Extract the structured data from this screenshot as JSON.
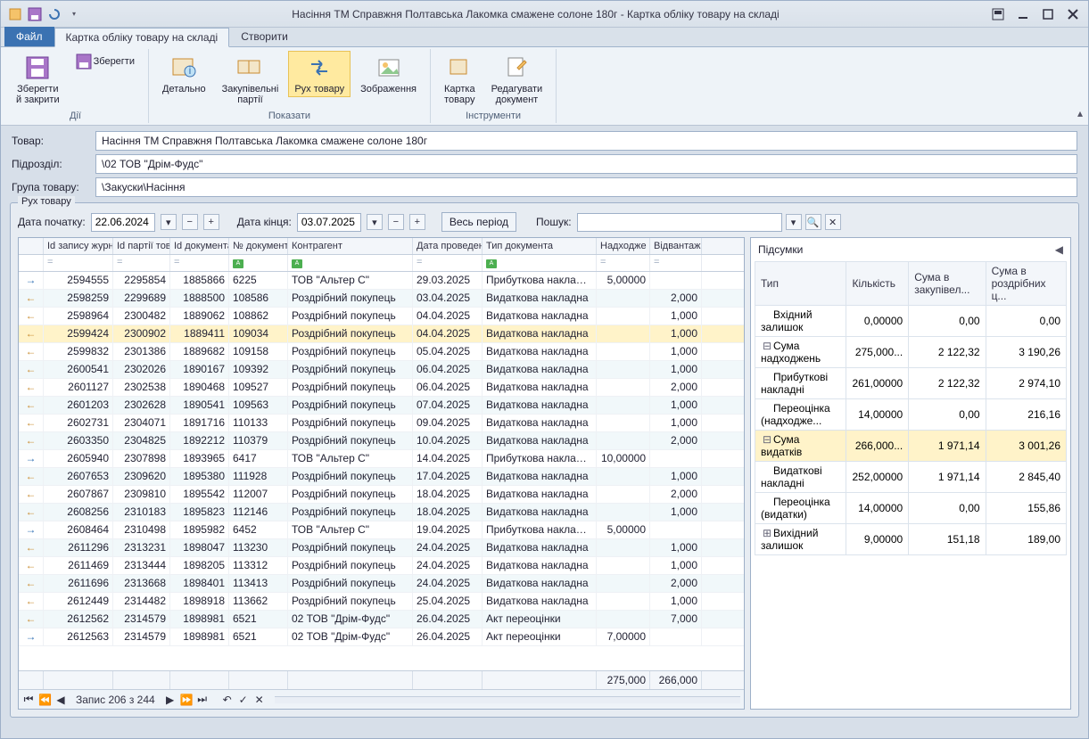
{
  "window": {
    "title": "Насіння ТМ Справжня Полтавська Лакомка смажене солоне 180г - Картка обліку товару на складі"
  },
  "tabs": {
    "file": "Файл",
    "card": "Картка обліку товару на складі",
    "create": "Створити"
  },
  "ribbon": {
    "actions_label": "Дії",
    "show_label": "Показати",
    "tools_label": "Інструменти",
    "save_close": "Зберегти\nй закрити",
    "save": "Зберегти",
    "detailed": "Детально",
    "purchase_batches": "Закупівельні\nпартії",
    "movement": "Рух товару",
    "image": "Зображення",
    "card": "Картка\nтовару",
    "edit_doc": "Редагувати\nдокумент"
  },
  "form": {
    "product_label": "Товар:",
    "product_value": "Насіння ТМ Справжня Полтавська Лакомка смажене солоне 180г",
    "division_label": "Підрозділ:",
    "division_value": "\\02 ТОВ \"Дрім-Фудс\"",
    "group_label": "Група товару:",
    "group_value": "\\Закуски\\Насіння"
  },
  "fieldset_legend": "Рух товару",
  "filter": {
    "dstart_label": "Дата початку:",
    "dstart": "22.06.2024",
    "dend_label": "Дата кінця:",
    "dend": "03.07.2025",
    "whole": "Весь період",
    "search_label": "Пошук:"
  },
  "cols": {
    "c0": "",
    "c1": "Id запису журналу о...",
    "c2": "Id партії товару",
    "c3": "Id документа",
    "c4": "№ документа",
    "c5": "Контрагент",
    "c6": "Дата проведення",
    "c7": "Тип документа",
    "c8": "Надходже ння",
    "c9": "Відвантаж ення"
  },
  "rows": [
    {
      "d": "in",
      "c1": "2594555",
      "c2": "2295854",
      "c3": "1885866",
      "c4": "6225",
      "c5": "ТОВ \"Альтер С\"",
      "c6": "29.03.2025",
      "c7": "Прибуткова накладна",
      "c8": "5,00000",
      "c9": ""
    },
    {
      "d": "out",
      "c1": "2598259",
      "c2": "2299689",
      "c3": "1888500",
      "c4": "108586",
      "c5": "Роздрібний покупець",
      "c6": "03.04.2025",
      "c7": "Видаткова накладна",
      "c8": "",
      "c9": "2,000"
    },
    {
      "d": "out",
      "c1": "2598964",
      "c2": "2300482",
      "c3": "1889062",
      "c4": "108862",
      "c5": "Роздрібний покупець",
      "c6": "04.04.2025",
      "c7": "Видаткова накладна",
      "c8": "",
      "c9": "1,000"
    },
    {
      "d": "out",
      "sel": true,
      "c1": "2599424",
      "c2": "2300902",
      "c3": "1889411",
      "c4": "109034",
      "c5": "Роздрібний покупець",
      "c6": "04.04.2025",
      "c7": "Видаткова накладна",
      "c8": "",
      "c9": "1,000"
    },
    {
      "d": "out",
      "c1": "2599832",
      "c2": "2301386",
      "c3": "1889682",
      "c4": "109158",
      "c5": "Роздрібний покупець",
      "c6": "05.04.2025",
      "c7": "Видаткова накладна",
      "c8": "",
      "c9": "1,000"
    },
    {
      "d": "out",
      "c1": "2600541",
      "c2": "2302026",
      "c3": "1890167",
      "c4": "109392",
      "c5": "Роздрібний покупець",
      "c6": "06.04.2025",
      "c7": "Видаткова накладна",
      "c8": "",
      "c9": "1,000"
    },
    {
      "d": "out",
      "c1": "2601127",
      "c2": "2302538",
      "c3": "1890468",
      "c4": "109527",
      "c5": "Роздрібний покупець",
      "c6": "06.04.2025",
      "c7": "Видаткова накладна",
      "c8": "",
      "c9": "2,000"
    },
    {
      "d": "out",
      "c1": "2601203",
      "c2": "2302628",
      "c3": "1890541",
      "c4": "109563",
      "c5": "Роздрібний покупець",
      "c6": "07.04.2025",
      "c7": "Видаткова накладна",
      "c8": "",
      "c9": "1,000"
    },
    {
      "d": "out",
      "c1": "2602731",
      "c2": "2304071",
      "c3": "1891716",
      "c4": "110133",
      "c5": "Роздрібний покупець",
      "c6": "09.04.2025",
      "c7": "Видаткова накладна",
      "c8": "",
      "c9": "1,000"
    },
    {
      "d": "out",
      "c1": "2603350",
      "c2": "2304825",
      "c3": "1892212",
      "c4": "110379",
      "c5": "Роздрібний покупець",
      "c6": "10.04.2025",
      "c7": "Видаткова накладна",
      "c8": "",
      "c9": "2,000"
    },
    {
      "d": "in",
      "c1": "2605940",
      "c2": "2307898",
      "c3": "1893965",
      "c4": "6417",
      "c5": "ТОВ \"Альтер С\"",
      "c6": "14.04.2025",
      "c7": "Прибуткова накладна",
      "c8": "10,00000",
      "c9": ""
    },
    {
      "d": "out",
      "c1": "2607653",
      "c2": "2309620",
      "c3": "1895380",
      "c4": "111928",
      "c5": "Роздрібний покупець",
      "c6": "17.04.2025",
      "c7": "Видаткова накладна",
      "c8": "",
      "c9": "1,000"
    },
    {
      "d": "out",
      "c1": "2607867",
      "c2": "2309810",
      "c3": "1895542",
      "c4": "112007",
      "c5": "Роздрібний покупець",
      "c6": "18.04.2025",
      "c7": "Видаткова накладна",
      "c8": "",
      "c9": "2,000"
    },
    {
      "d": "out",
      "c1": "2608256",
      "c2": "2310183",
      "c3": "1895823",
      "c4": "112146",
      "c5": "Роздрібний покупець",
      "c6": "18.04.2025",
      "c7": "Видаткова накладна",
      "c8": "",
      "c9": "1,000"
    },
    {
      "d": "in",
      "c1": "2608464",
      "c2": "2310498",
      "c3": "1895982",
      "c4": "6452",
      "c5": "ТОВ \"Альтер С\"",
      "c6": "19.04.2025",
      "c7": "Прибуткова накладна",
      "c8": "5,00000",
      "c9": ""
    },
    {
      "d": "out",
      "c1": "2611296",
      "c2": "2313231",
      "c3": "1898047",
      "c4": "113230",
      "c5": "Роздрібний покупець",
      "c6": "24.04.2025",
      "c7": "Видаткова накладна",
      "c8": "",
      "c9": "1,000"
    },
    {
      "d": "out",
      "c1": "2611469",
      "c2": "2313444",
      "c3": "1898205",
      "c4": "113312",
      "c5": "Роздрібний покупець",
      "c6": "24.04.2025",
      "c7": "Видаткова накладна",
      "c8": "",
      "c9": "1,000"
    },
    {
      "d": "out",
      "c1": "2611696",
      "c2": "2313668",
      "c3": "1898401",
      "c4": "113413",
      "c5": "Роздрібний покупець",
      "c6": "24.04.2025",
      "c7": "Видаткова накладна",
      "c8": "",
      "c9": "2,000"
    },
    {
      "d": "out",
      "c1": "2612449",
      "c2": "2314482",
      "c3": "1898918",
      "c4": "113662",
      "c5": "Роздрібний покупець",
      "c6": "25.04.2025",
      "c7": "Видаткова накладна",
      "c8": "",
      "c9": "1,000"
    },
    {
      "d": "out",
      "c1": "2612562",
      "c2": "2314579",
      "c3": "1898981",
      "c4": "6521",
      "c5": "02 ТОВ \"Дрім-Фудс\"",
      "c6": "26.04.2025",
      "c7": "Акт переоцінки",
      "c8": "",
      "c9": "7,000"
    },
    {
      "d": "in",
      "c1": "2612563",
      "c2": "2314579",
      "c3": "1898981",
      "c4": "6521",
      "c5": "02 ТОВ \"Дрім-Фудс\"",
      "c6": "26.04.2025",
      "c7": "Акт переоцінки",
      "c8": "7,00000",
      "c9": ""
    }
  ],
  "foot": {
    "t8": "275,000",
    "t9": "266,000"
  },
  "navbar": {
    "record": "Запис 206 з 244"
  },
  "summary": {
    "title": "Підсумки",
    "h1": "Тип",
    "h2": "Кількість",
    "h3": "Сума в закупівел...",
    "h4": "Сума в роздрібних ц...",
    "rows": [
      {
        "t": "Вхідний залишок",
        "k": "0,00000",
        "s1": "0,00",
        "s2": "0,00",
        "tr": " "
      },
      {
        "t": "Сума надходжень",
        "k": "275,000...",
        "s1": "2 122,32",
        "s2": "3 190,26",
        "tr": "⊟"
      },
      {
        "t": "Прибуткові накладні",
        "k": "261,00000",
        "s1": "2 122,32",
        "s2": "2 974,10",
        "tr": ""
      },
      {
        "t": "Переоцінка (надходже...",
        "k": "14,00000",
        "s1": "0,00",
        "s2": "216,16",
        "tr": ""
      },
      {
        "t": "Сума видатків",
        "k": "266,000...",
        "s1": "1 971,14",
        "s2": "3 001,26",
        "tr": "⊟",
        "hl": true
      },
      {
        "t": "Видаткові накладні",
        "k": "252,00000",
        "s1": "1 971,14",
        "s2": "2 845,40",
        "tr": ""
      },
      {
        "t": "Переоцінка (видатки)",
        "k": "14,00000",
        "s1": "0,00",
        "s2": "155,86",
        "tr": ""
      },
      {
        "t": "Вихідний залишок",
        "k": "9,00000",
        "s1": "151,18",
        "s2": "189,00",
        "tr": "⊞"
      }
    ]
  }
}
